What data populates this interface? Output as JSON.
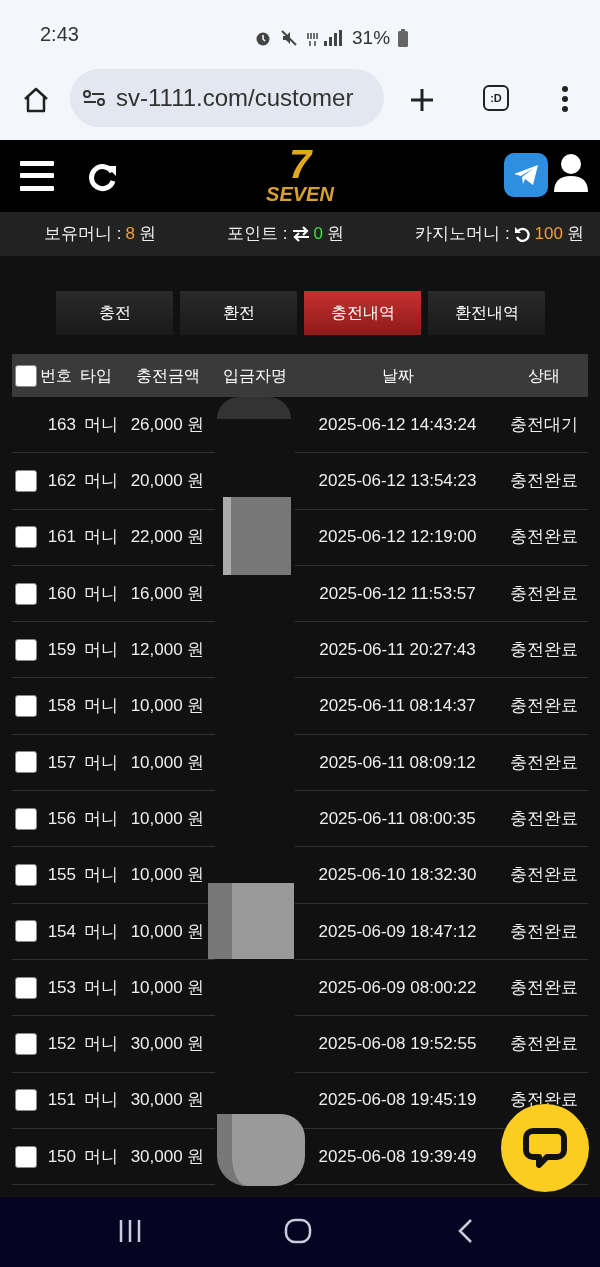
{
  "status_bar": {
    "time": "2:43",
    "battery": "31%"
  },
  "browser": {
    "url": "sv-1111.com/customer",
    "tab_label": ":D"
  },
  "header": {
    "logo_number": "7",
    "logo_text": "SEVEN"
  },
  "balances": [
    {
      "label": "보유머니 :",
      "value": "8",
      "unit": "원",
      "kind": "plain",
      "color": "#f0a030"
    },
    {
      "label": "포인트 :",
      "value": "0",
      "unit": "원",
      "kind": "exchange",
      "color": "#44dd44"
    },
    {
      "label": "카지노머니 :",
      "value": "100",
      "unit": "원",
      "kind": "refresh",
      "color": "#f0a030"
    }
  ],
  "tabs": [
    {
      "label": "충전",
      "selected": false
    },
    {
      "label": "환전",
      "selected": false
    },
    {
      "label": "충전내역",
      "selected": true
    },
    {
      "label": "환전내역",
      "selected": false
    }
  ],
  "table": {
    "select_all": {
      "checked": false
    },
    "columns": [
      "번호",
      "타입",
      "충전금액",
      "입금자명",
      "날짜",
      "상태"
    ],
    "rows": [
      {
        "number": "163",
        "type": "머니",
        "amount": "26,000 원",
        "date": "2025-06-12 14:43:24",
        "status": "충전대기"
      },
      {
        "checked": false,
        "number": "162",
        "type": "머니",
        "amount": "20,000 원",
        "date": "2025-06-12 13:54:23",
        "status": "충전완료"
      },
      {
        "checked": false,
        "number": "161",
        "type": "머니",
        "amount": "22,000 원",
        "date": "2025-06-12 12:19:00",
        "status": "충전완료"
      },
      {
        "checked": false,
        "number": "160",
        "type": "머니",
        "amount": "16,000 원",
        "date": "2025-06-12 11:53:57",
        "status": "충전완료"
      },
      {
        "checked": false,
        "number": "159",
        "type": "머니",
        "amount": "12,000 원",
        "date": "2025-06-11 20:27:43",
        "status": "충전완료"
      },
      {
        "checked": false,
        "number": "158",
        "type": "머니",
        "amount": "10,000 원",
        "date": "2025-06-11 08:14:37",
        "status": "충전완료"
      },
      {
        "checked": false,
        "number": "157",
        "type": "머니",
        "amount": "10,000 원",
        "date": "2025-06-11 08:09:12",
        "status": "충전완료"
      },
      {
        "checked": false,
        "number": "156",
        "type": "머니",
        "amount": "10,000 원",
        "date": "2025-06-11 08:00:35",
        "status": "충전완료"
      },
      {
        "checked": false,
        "number": "155",
        "type": "머니",
        "amount": "10,000 원",
        "date": "2025-06-10 18:32:30",
        "status": "충전완료"
      },
      {
        "checked": false,
        "number": "154",
        "type": "머니",
        "amount": "10,000 원",
        "date": "2025-06-09 18:47:12",
        "status": "충전완료"
      },
      {
        "checked": false,
        "number": "153",
        "type": "머니",
        "amount": "10,000 원",
        "date": "2025-06-09 08:00:22",
        "status": "충전완료"
      },
      {
        "checked": false,
        "number": "152",
        "type": "머니",
        "amount": "30,000 원",
        "date": "2025-06-08 19:52:55",
        "status": "충전완료"
      },
      {
        "checked": false,
        "number": "151",
        "type": "머니",
        "amount": "30,000 원",
        "date": "2025-06-08 19:45:19",
        "status": "충전완료"
      },
      {
        "checked": false,
        "number": "150",
        "type": "머니",
        "amount": "30,000 원",
        "date": "2025-06-08 19:39:49"
      }
    ]
  }
}
